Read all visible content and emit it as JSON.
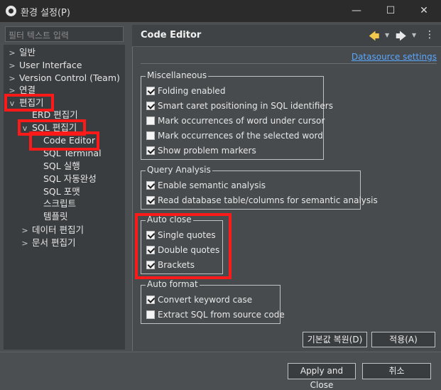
{
  "window": {
    "title": "환경 설정(P)",
    "minimize": "—",
    "maximize": "☐",
    "close": "✕"
  },
  "filter": {
    "placeholder": "필터 텍스트 입력"
  },
  "tree": [
    {
      "label": "일반",
      "twisty": ">"
    },
    {
      "label": "User Interface",
      "twisty": ">"
    },
    {
      "label": "Version Control (Team)",
      "twisty": ">"
    },
    {
      "label": "연결",
      "twisty": ">"
    },
    {
      "label": "편집기",
      "twisty": "v"
    },
    {
      "label": "ERD 편집기",
      "twisty": ""
    },
    {
      "label": "SQL 편집기",
      "twisty": "v"
    },
    {
      "label": "Code Editor",
      "twisty": ""
    },
    {
      "label": "SQL Terminal",
      "twisty": ""
    },
    {
      "label": "SQL 실행",
      "twisty": ""
    },
    {
      "label": "SQL 자동완성",
      "twisty": ""
    },
    {
      "label": "SQL 포맷",
      "twisty": ""
    },
    {
      "label": "스크립트",
      "twisty": ""
    },
    {
      "label": "템플릿",
      "twisty": ""
    },
    {
      "label": "데이터 편집기",
      "twisty": ">"
    },
    {
      "label": "문서 편집기",
      "twisty": ">"
    }
  ],
  "page": {
    "title": "Code Editor",
    "datasource_link": "Datasource settings"
  },
  "groups": {
    "misc": {
      "title": "Miscellaneous",
      "options": [
        {
          "label": "Folding enabled",
          "checked": true
        },
        {
          "label": "Smart caret positioning in SQL identifiers",
          "checked": true
        },
        {
          "label": "Mark occurrences of word under cursor",
          "checked": false
        },
        {
          "label": "Mark occurrences of the selected word",
          "checked": false
        },
        {
          "label": "Show problem markers",
          "checked": true
        }
      ]
    },
    "query": {
      "title": "Query Analysis",
      "options": [
        {
          "label": "Enable semantic analysis",
          "checked": true
        },
        {
          "label": "Read database table/columns for semantic analysis",
          "checked": true
        }
      ]
    },
    "autoclose": {
      "title": "Auto close",
      "options": [
        {
          "label": "Single quotes",
          "checked": true
        },
        {
          "label": "Double quotes",
          "checked": true
        },
        {
          "label": "Brackets",
          "checked": true
        }
      ]
    },
    "autoformat": {
      "title": "Auto format",
      "options": [
        {
          "label": "Convert keyword case",
          "checked": true
        },
        {
          "label": "Extract SQL from source code",
          "checked": false
        }
      ]
    }
  },
  "buttons": {
    "restore_defaults": "기본값 복원(D)",
    "apply": "적용(A)",
    "apply_close": "Apply and Close",
    "cancel": "취소"
  },
  "colors": {
    "highlight": "#ff1a1a",
    "link": "#5aa7ff",
    "nav_back": "#f2c94c"
  }
}
